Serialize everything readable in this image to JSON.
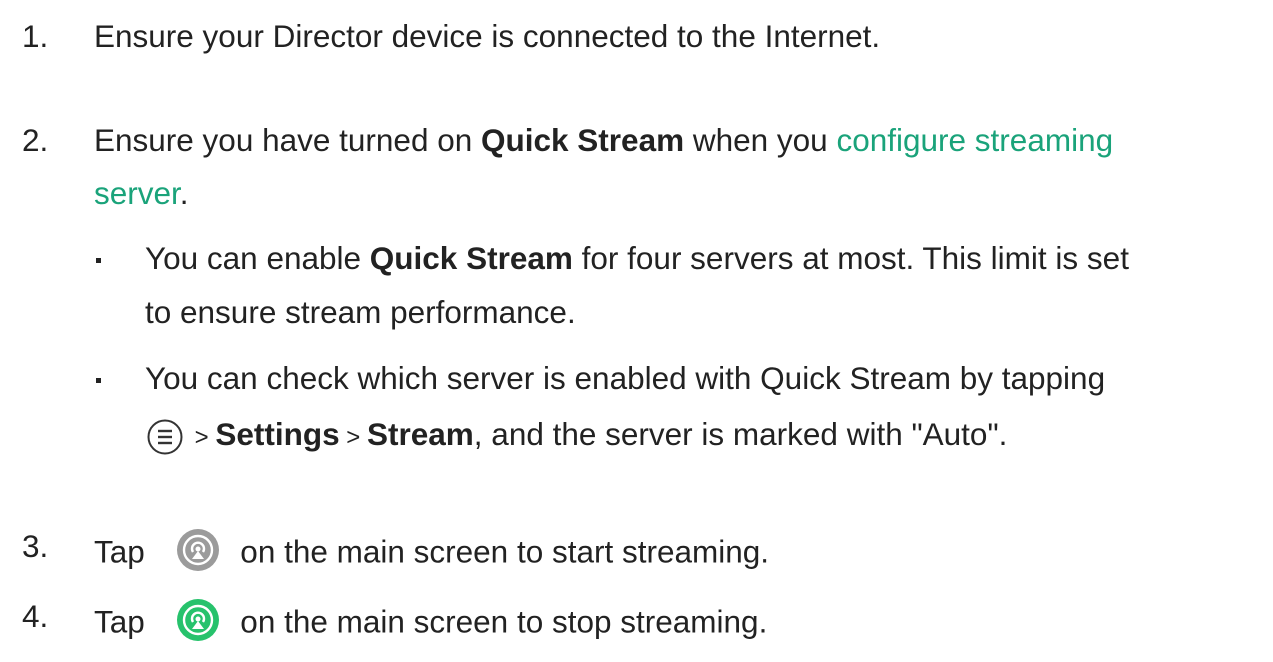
{
  "steps": [
    {
      "num": "1.",
      "text": "Ensure your Director device is connected to the Internet."
    },
    {
      "num": "2.",
      "t1": "Ensure you have turned on ",
      "bold": "Quick Stream",
      "t2": " when you ",
      "link1": "configure streaming",
      "link2": "server",
      "t3": "."
    },
    {
      "num": "3.",
      "t1": "Tap ",
      "t2": " on the main screen to start streaming.",
      "icon": "stream-gray-icon"
    },
    {
      "num": "4.",
      "t1": "Tap ",
      "t2": " on the main screen to stop streaming.",
      "icon": "stream-green-icon"
    }
  ],
  "bullets": [
    {
      "t1": "You can enable ",
      "bold": "Quick Stream",
      "t2": " for four servers at most. This limit is set",
      "line2": "to ensure stream performance."
    },
    {
      "t1": "You can check which server is enabled with Quick Stream by tapping",
      "icon": "menu-icon",
      "sep1": " > ",
      "b1": "Settings",
      "sep2": " > ",
      "b2": "Stream",
      "t2": ", and the server is marked with \"Auto\"."
    }
  ],
  "colors": {
    "link": "#1aa37a",
    "stream_gray": "#9b9b9b",
    "stream_green": "#27c26c"
  }
}
